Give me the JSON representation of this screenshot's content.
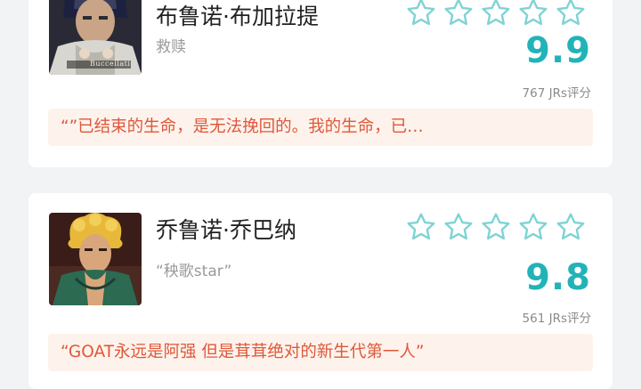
{
  "colors": {
    "accent": "#22b3b8",
    "quote_text": "#e0573a",
    "quote_bg": "#fdf3ec",
    "background": "#f2f3f5"
  },
  "cards": [
    {
      "name": "布鲁诺·布加拉提",
      "subtitle": "救赎",
      "score": "9.9",
      "raters": "767 JRs评分",
      "quote": "“”已结束的生命，是无法挽回的。我的生命，已…",
      "avatar_caption": "Buccellati",
      "stars_filled": 0,
      "stars_total": 5,
      "star_icon": "star-outline-icon"
    },
    {
      "name": "乔鲁诺·乔巴纳",
      "subtitle": "“秧歌star”",
      "score": "9.8",
      "raters": "561 JRs评分",
      "quote": "“GOAT永远是阿强 但是茸茸绝对的新生代第一人”",
      "stars_filled": 0,
      "stars_total": 5,
      "star_icon": "star-outline-icon"
    }
  ]
}
